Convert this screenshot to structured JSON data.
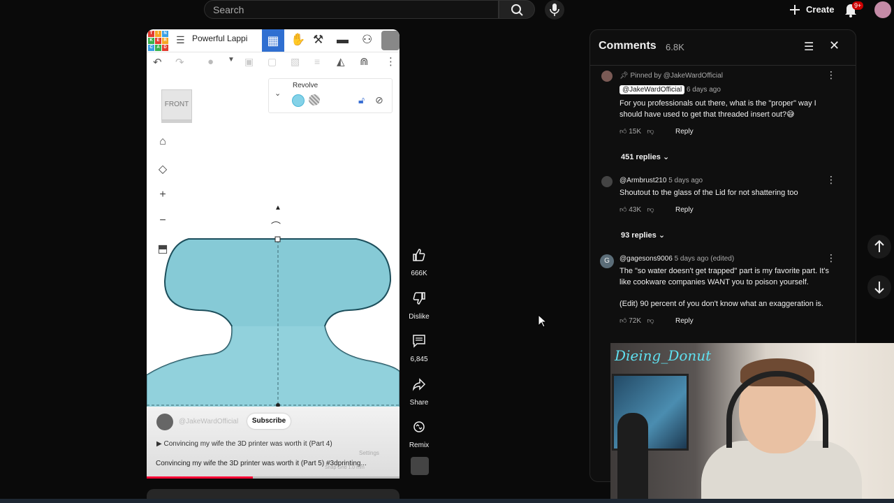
{
  "topbar": {
    "search_placeholder": "Search",
    "create_label": "Create",
    "notification_count": "9+"
  },
  "tinkercad": {
    "logo_letters": [
      "T",
      "I",
      "N",
      "K",
      "E",
      "R",
      "C",
      "A",
      "D"
    ],
    "title": "Powerful Lappi",
    "view_cube_label": "FRONT",
    "shape_panel_title": "Revolve"
  },
  "short": {
    "channel": "@JakeWardOfficial",
    "subscribe_label": "Subscribe",
    "playlist_item": "Convincing my wife the 3D printer was worth it (Part 4)",
    "caption": "Convincing my wife the 3D printer was worth it (Part 5) #3dprinting...",
    "faded_settings": "Settings",
    "faded_snap": "Snap Grid   1.0 mm",
    "progress": 0.42
  },
  "actions": {
    "likes": "666K",
    "dislike_label": "Dislike",
    "comments": "6,845",
    "share_label": "Share",
    "remix_label": "Remix"
  },
  "comments": {
    "title": "Comments",
    "count": "6.8K",
    "items": [
      {
        "pinned_label": "Pinned by @JakeWardOfficial",
        "author": "@JakeWardOfficial",
        "time": "6 days ago",
        "text": "For you professionals out there, what is the \"proper\" way I should have used to get that threaded insert out?😅",
        "likes": "15K",
        "reply_label": "Reply",
        "replies_label": "451 replies"
      },
      {
        "author": "@Armbrust210",
        "time": "5 days ago",
        "text": "Shoutout to the glass of the Lid for not shattering too",
        "likes": "43K",
        "reply_label": "Reply",
        "replies_label": "93 replies"
      },
      {
        "avatar_letter": "G",
        "author": "@gagesons9006",
        "time": "5 days ago (edited)",
        "text": "The \"so water doesn't get trapped\" part is my favorite part. It's like cookware companies WANT you to poison yourself.",
        "text_edit": "(Edit) 90 percent of you don't know what an exaggeration is.",
        "likes": "72K",
        "reply_label": "Reply"
      }
    ]
  },
  "webcam": {
    "overlay_name": "Dieing_Donut"
  },
  "colors": {
    "shape_fill": "#86cad6",
    "tinkercad_blue": "#2f6fd1",
    "progress_red": "#ff0033",
    "webcam_name": "#5fe0f0"
  }
}
